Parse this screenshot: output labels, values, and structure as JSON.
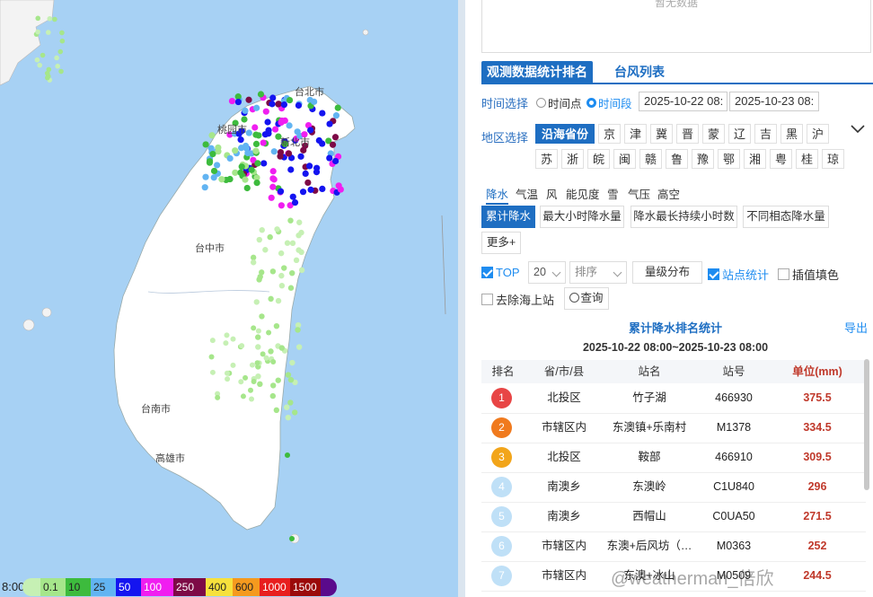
{
  "map": {
    "time_fragment": "8:00",
    "cities": [
      {
        "name": "台北市"
      },
      {
        "name": "桃园市"
      },
      {
        "name": "新北市"
      },
      {
        "name": "台中市"
      },
      {
        "name": "台南市"
      },
      {
        "name": "高雄市"
      }
    ],
    "legend": [
      {
        "label": "",
        "color": "#c6f0b4"
      },
      {
        "label": "0.1",
        "color": "#a6e68b"
      },
      {
        "label": "10",
        "color": "#3dbb3d"
      },
      {
        "label": "25",
        "color": "#62b4f2"
      },
      {
        "label": "50",
        "color": "#1414f0"
      },
      {
        "label": "100",
        "color": "#f01ef0"
      },
      {
        "label": "250",
        "color": "#7d0a46"
      },
      {
        "label": "400",
        "color": "#f7e13c"
      },
      {
        "label": "600",
        "color": "#f59a1e"
      },
      {
        "label": "1000",
        "color": "#e81e1e"
      },
      {
        "label": "1500",
        "color": "#9b0a0a"
      },
      {
        "label": "",
        "color": "#5a0a8c"
      }
    ]
  },
  "panel": {
    "nodata_text": "暂无数据",
    "tabs": [
      "观测数据统计排名",
      "台风列表"
    ],
    "time_label": "时间选择",
    "time_options": [
      "时间点",
      "时间段"
    ],
    "time_selected": "时间段",
    "start_time": "2025-10-22 08:",
    "end_time": "2025-10-23 08:",
    "region_label": "地区选择",
    "region_selected": "沿海省份",
    "provinces_row1": [
      "京",
      "津",
      "冀",
      "晋",
      "蒙",
      "辽",
      "吉",
      "黑",
      "沪"
    ],
    "provinces_row2": [
      "苏",
      "浙",
      "皖",
      "闽",
      "赣",
      "鲁",
      "豫",
      "鄂",
      "湘",
      "粤",
      "桂",
      "琼"
    ],
    "elements": [
      "降水",
      "气温",
      "风",
      "能见度",
      "雪",
      "气压",
      "高空"
    ],
    "element_selected": "降水",
    "sub_buttons": [
      "累计降水",
      "最大小时降水量",
      "降水最长持续小时数",
      "不同相态降水量"
    ],
    "more_label": "更多+",
    "top_label": "TOP",
    "top_count": "20",
    "sort_label": "排序",
    "grade_label": "量级分布",
    "station_stat_label": "站点统计",
    "fill_label": "插值填色",
    "remove_sea_label": "去除海上站",
    "query_label": "查询",
    "stat_title": "累计降水排名统计",
    "export_label": "导出",
    "stat_range": "2025-10-22 08:00~2025-10-23 08:00",
    "table_headers": [
      "排名",
      "省/市/县",
      "站名",
      "站号",
      "单位(mm)"
    ],
    "rows": [
      {
        "rank": "1",
        "area": "北投区",
        "station": "竹子湖",
        "id": "466930",
        "value": "375.5",
        "color": "#e84545"
      },
      {
        "rank": "2",
        "area": "市辖区内",
        "station": "东澳镇+乐南村",
        "id": "M1378",
        "value": "334.5",
        "color": "#f07a1e"
      },
      {
        "rank": "3",
        "area": "北投区",
        "station": "鞍部",
        "id": "466910",
        "value": "309.5",
        "color": "#f2a51a"
      },
      {
        "rank": "4",
        "area": "南澳乡",
        "station": "东澳岭",
        "id": "C1U840",
        "value": "296",
        "color": "#bfe0f7"
      },
      {
        "rank": "5",
        "area": "南澳乡",
        "station": "西帽山",
        "id": "C0UA50",
        "value": "271.5",
        "color": "#bfe0f7"
      },
      {
        "rank": "6",
        "area": "市辖区内",
        "station": "东澳+后风坊（…",
        "id": "M0363",
        "value": "252",
        "color": "#bfe0f7"
      },
      {
        "rank": "7",
        "area": "市辖区内",
        "station": "东澳+冰山",
        "id": "M0509",
        "value": "244.5",
        "color": "#bfe0f7"
      }
    ]
  },
  "watermark": "@weatherman_倍欣"
}
